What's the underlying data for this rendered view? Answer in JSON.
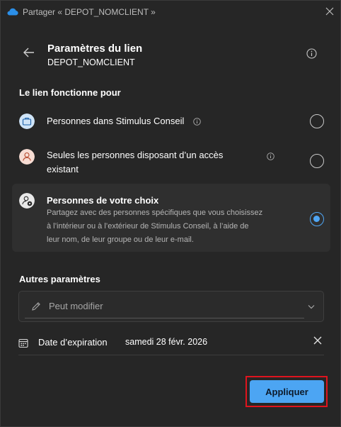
{
  "window": {
    "title": "Partager « DEPOT_NOMCLIENT »",
    "app_icon": "onedrive-cloud-icon",
    "close_icon": "close-icon"
  },
  "header": {
    "title": "Paramètres du lien",
    "subtitle": "DEPOT_NOMCLIENT",
    "back_icon": "arrow-left-icon",
    "info_icon": "info-icon"
  },
  "link_works_for": {
    "heading": "Le lien fonctionne pour",
    "options": [
      {
        "title": "Personnes dans Stimulus Conseil",
        "icon": "briefcase-icon",
        "checked": false
      },
      {
        "title": "Seules les personnes disposant d’un accès existant",
        "line1": "Seules les personnes disposant d’un accès",
        "line2": "existant",
        "icon": "person-icon",
        "checked": false
      },
      {
        "title": "Personnes de votre choix",
        "description": "Partagez avec des personnes spécifiques que vous choisissez à l’intérieur ou à l’extérieur de Stimulus Conseil, à l’aide de leur nom, de leur groupe ou de leur e-mail.",
        "desc_line1": "Partagez avec des personnes spécifiques que vous choisissez",
        "desc_line2": "à l’intérieur ou à l’extérieur de Stimulus Conseil, à l’aide de",
        "desc_line3": "leur nom, de leur groupe ou de leur e-mail.",
        "icon": "people-settings-icon",
        "checked": true
      }
    ]
  },
  "other_settings": {
    "heading": "Autres paramètres",
    "permission": {
      "value": "Peut modifier",
      "icon": "pencil-icon",
      "chevron": "chevron-down-icon"
    },
    "expiration": {
      "label": "Date d’expiration",
      "value": "samedi 28 févr. 2026",
      "icon": "calendar-icon",
      "clear_icon": "close-icon"
    }
  },
  "actions": {
    "apply_label": "Appliquer"
  },
  "colors": {
    "accent": "#4ca5f3",
    "highlight_outline": "#e0141e",
    "background": "#262626"
  }
}
